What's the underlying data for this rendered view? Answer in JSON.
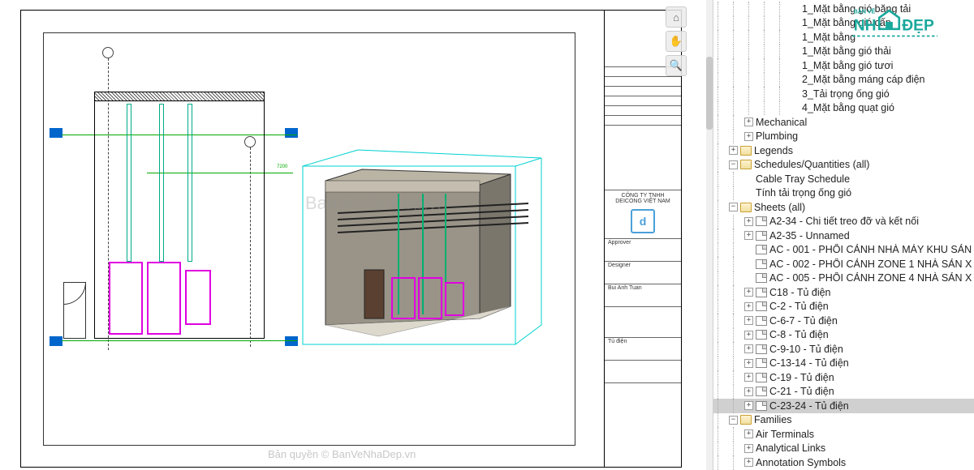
{
  "watermarks": {
    "main": "BanVeNhaDep.vn",
    "copyright": "Bản quyền © BanVeNhaDep.vn"
  },
  "titleblock": {
    "company": "CÔNG TY TNHH DEICONG VIỆT NAM",
    "approver": "Approver",
    "designer": "Designer",
    "author": "Bui Anh Tuan",
    "sheet": "Tủ điện"
  },
  "logo": {
    "text_top": "BẢN VẼ",
    "text_main": "NHÀ",
    "text_right": "ĐẸP"
  },
  "tree": [
    {
      "indent": 5,
      "exp": "",
      "icon": "",
      "label": "1_Mặt bằng gió băng tải"
    },
    {
      "indent": 5,
      "exp": "",
      "icon": "",
      "label": "1_Mặt bằng gió cấp"
    },
    {
      "indent": 5,
      "exp": "",
      "icon": "",
      "label": "1_Mặt bằng"
    },
    {
      "indent": 5,
      "exp": "",
      "icon": "",
      "label": "1_Mặt bằng gió thải"
    },
    {
      "indent": 5,
      "exp": "",
      "icon": "",
      "label": "1_Mặt bằng gió tươi"
    },
    {
      "indent": 5,
      "exp": "",
      "icon": "",
      "label": "2_Mặt bằng máng cáp điện"
    },
    {
      "indent": 5,
      "exp": "",
      "icon": "",
      "label": "3_Tải trọng ống gió"
    },
    {
      "indent": 5,
      "exp": "",
      "icon": "",
      "label": "4_Mặt bằng quạt gió"
    },
    {
      "indent": 2,
      "exp": "+",
      "icon": "",
      "label": "Mechanical"
    },
    {
      "indent": 2,
      "exp": "+",
      "icon": "",
      "label": "Plumbing"
    },
    {
      "indent": 1,
      "exp": "+",
      "icon": "folder",
      "label": "Legends"
    },
    {
      "indent": 1,
      "exp": "-",
      "icon": "folder",
      "label": "Schedules/Quantities (all)"
    },
    {
      "indent": 2,
      "exp": "",
      "icon": "",
      "label": "Cable Tray Schedule"
    },
    {
      "indent": 2,
      "exp": "",
      "icon": "",
      "label": "Tính tải trọng ống gió"
    },
    {
      "indent": 1,
      "exp": "-",
      "icon": "folder",
      "label": "Sheets (all)"
    },
    {
      "indent": 2,
      "exp": "+",
      "icon": "sheet",
      "label": "A2-34 - Chi tiết treo đỡ và kết nối"
    },
    {
      "indent": 2,
      "exp": "+",
      "icon": "sheet",
      "label": "A2-35 - Unnamed"
    },
    {
      "indent": 2,
      "exp": "",
      "icon": "sheet",
      "label": "AC - 001 - PHỐI CẢNH NHÀ MÁY KHU SẢN"
    },
    {
      "indent": 2,
      "exp": "",
      "icon": "sheet",
      "label": "AC - 002 - PHỐI CẢNH ZONE 1 NHÀ SẢN X"
    },
    {
      "indent": 2,
      "exp": "",
      "icon": "sheet",
      "label": "AC - 005 - PHỐI CẢNH ZONE 4 NHÀ SẢN X"
    },
    {
      "indent": 2,
      "exp": "+",
      "icon": "sheet",
      "label": "C18 - Tủ điện"
    },
    {
      "indent": 2,
      "exp": "+",
      "icon": "sheet",
      "label": "C-2 - Tủ điện"
    },
    {
      "indent": 2,
      "exp": "+",
      "icon": "sheet",
      "label": "C-6-7 - Tủ điện"
    },
    {
      "indent": 2,
      "exp": "+",
      "icon": "sheet",
      "label": "C-8 - Tủ điện"
    },
    {
      "indent": 2,
      "exp": "+",
      "icon": "sheet",
      "label": "C-9-10 - Tủ điện"
    },
    {
      "indent": 2,
      "exp": "+",
      "icon": "sheet",
      "label": "C-13-14 - Tủ điện"
    },
    {
      "indent": 2,
      "exp": "+",
      "icon": "sheet",
      "label": "C-19 - Tủ điện"
    },
    {
      "indent": 2,
      "exp": "+",
      "icon": "sheet",
      "label": "C-21 - Tủ điện"
    },
    {
      "indent": 2,
      "exp": "+",
      "icon": "sheet",
      "label": "C-23-24 - Tủ điện",
      "selected": true
    },
    {
      "indent": 1,
      "exp": "-",
      "icon": "folder",
      "label": "Families"
    },
    {
      "indent": 2,
      "exp": "+",
      "icon": "",
      "label": "Air Terminals"
    },
    {
      "indent": 2,
      "exp": "+",
      "icon": "",
      "label": "Analytical Links"
    },
    {
      "indent": 2,
      "exp": "+",
      "icon": "",
      "label": "Annotation Symbols"
    }
  ]
}
